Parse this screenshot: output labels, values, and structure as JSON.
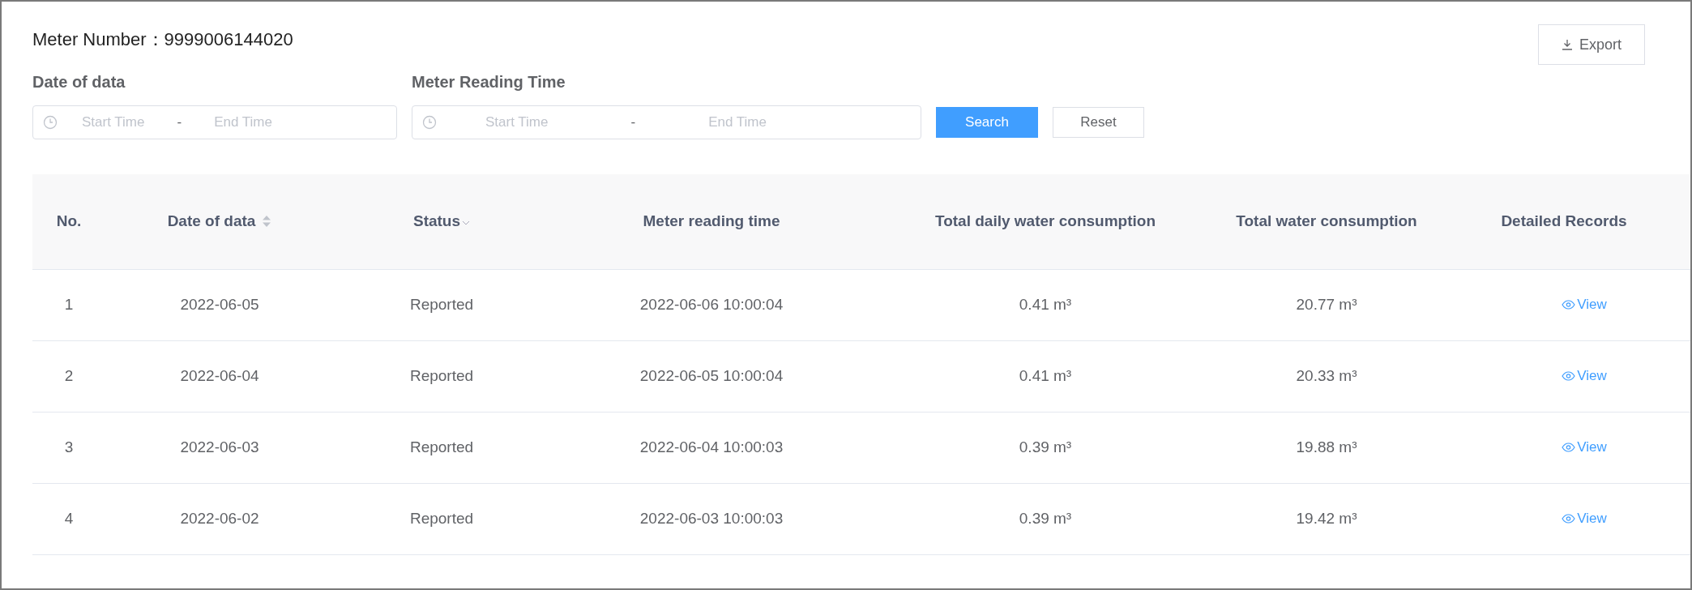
{
  "meter": {
    "label": "Meter Number：",
    "value": "9999006144020"
  },
  "export_button": {
    "label": "Export"
  },
  "filters": [
    {
      "label": "Date of data",
      "start_placeholder": "Start Time",
      "separator": "-",
      "end_placeholder": "End Time"
    },
    {
      "label": "Meter Reading Time",
      "start_placeholder": "Start Time",
      "separator": "-",
      "end_placeholder": "End Time"
    }
  ],
  "buttons": [
    {
      "label": "Search",
      "kind": "primary"
    },
    {
      "label": "Reset",
      "kind": "default"
    }
  ],
  "table": {
    "columns": [
      {
        "label": "No.",
        "kind": "plain"
      },
      {
        "label": "Date of data",
        "kind": "sortable"
      },
      {
        "label": "Status",
        "kind": "filter"
      },
      {
        "label": "Meter reading time",
        "kind": "plain"
      },
      {
        "label": "Total daily water consumption",
        "kind": "plain"
      },
      {
        "label": "Total water consumption",
        "kind": "plain"
      },
      {
        "label": "Detailed Records",
        "kind": "plain"
      }
    ],
    "rows": [
      {
        "no": "1",
        "date": "2022-06-05",
        "status": "Reported",
        "reading_time": "2022-06-06 10:00:04",
        "daily": "0.41 m³",
        "total": "20.77 m³",
        "action": "View"
      },
      {
        "no": "2",
        "date": "2022-06-04",
        "status": "Reported",
        "reading_time": "2022-06-05 10:00:04",
        "daily": "0.41 m³",
        "total": "20.33 m³",
        "action": "View"
      },
      {
        "no": "3",
        "date": "2022-06-03",
        "status": "Reported",
        "reading_time": "2022-06-04 10:00:03",
        "daily": "0.39 m³",
        "total": "19.88 m³",
        "action": "View"
      },
      {
        "no": "4",
        "date": "2022-06-02",
        "status": "Reported",
        "reading_time": "2022-06-03 10:00:03",
        "daily": "0.39 m³",
        "total": "19.42 m³",
        "action": "View"
      }
    ]
  }
}
